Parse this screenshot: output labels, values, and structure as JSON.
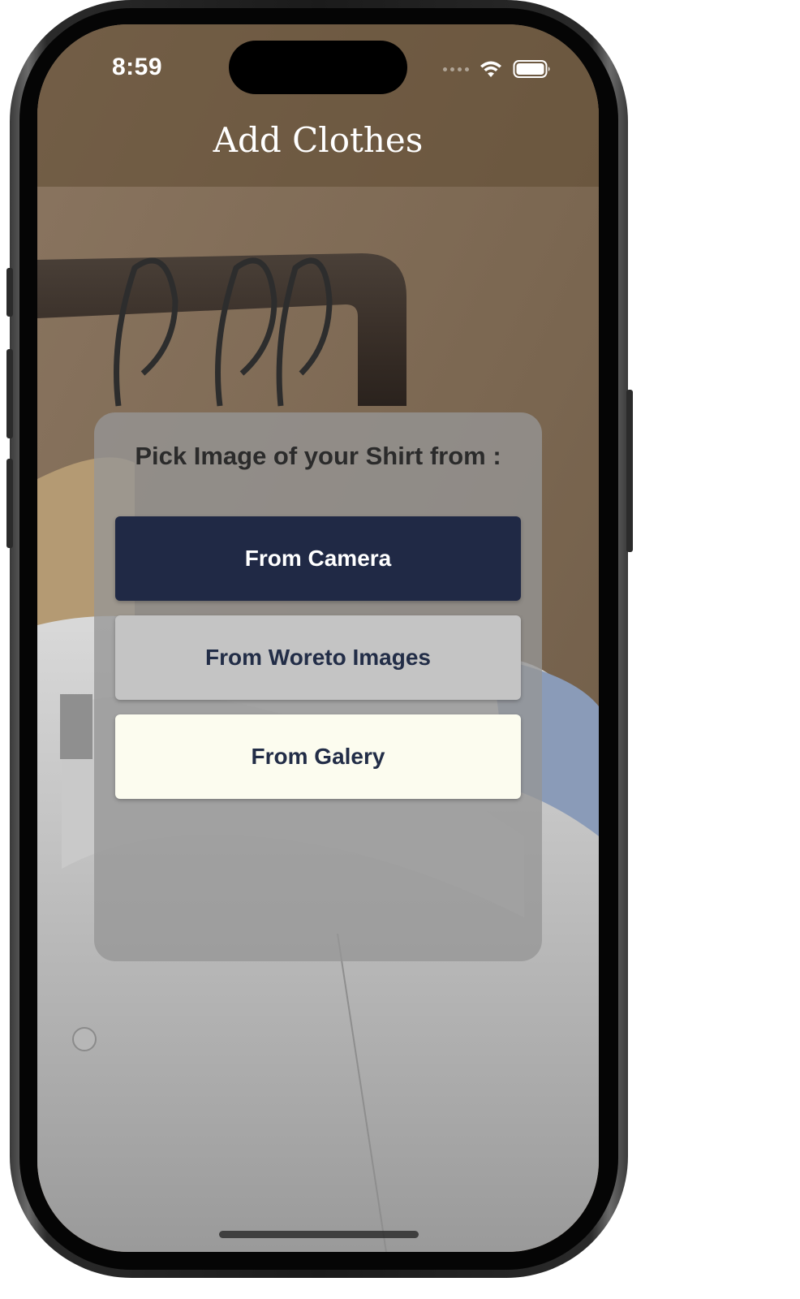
{
  "status_bar": {
    "time": "8:59",
    "icons": [
      "cellular-signal-icon",
      "wifi-icon",
      "battery-icon"
    ]
  },
  "nav": {
    "title": "Add Clothes"
  },
  "picker": {
    "title": "Pick Image of your Shirt from :",
    "buttons": {
      "camera": "From Camera",
      "woreto": "From Woreto Images",
      "gallery": "From Galery"
    }
  },
  "colors": {
    "primary_button": "#202945",
    "secondary_button": "#c4c4c4",
    "tertiary_button": "#fcfcef",
    "button_text_dark": "#222d47"
  }
}
